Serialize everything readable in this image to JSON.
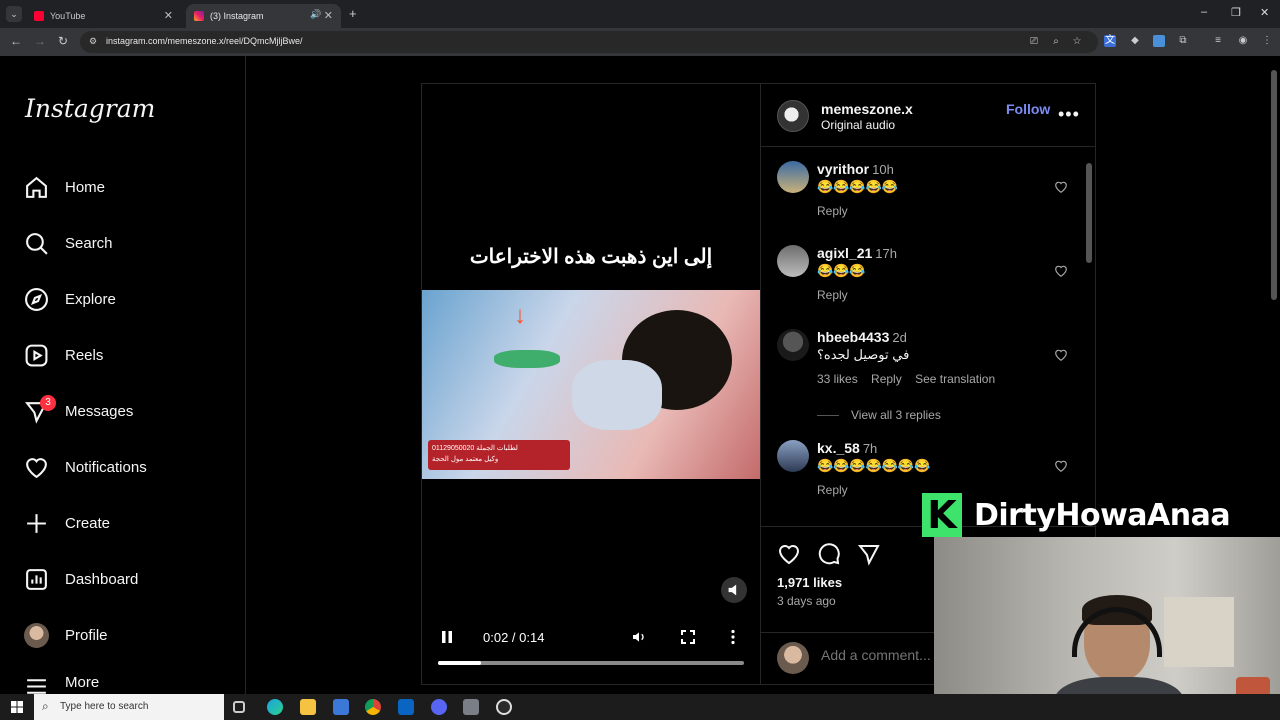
{
  "browser": {
    "tabs": [
      {
        "title": "YouTube",
        "active": false
      },
      {
        "title": "(3) Instagram",
        "active": true
      }
    ],
    "url": "instagram.com/memeszone.x/reel/DQmcMjljBwe/"
  },
  "sidebar": {
    "logo": "Instagram",
    "items": [
      {
        "label": "Home",
        "icon": "home-icon"
      },
      {
        "label": "Search",
        "icon": "search-icon"
      },
      {
        "label": "Explore",
        "icon": "compass-icon"
      },
      {
        "label": "Reels",
        "icon": "reels-icon"
      },
      {
        "label": "Messages",
        "icon": "messenger-icon",
        "badge": "3"
      },
      {
        "label": "Notifications",
        "icon": "heart-icon"
      },
      {
        "label": "Create",
        "icon": "plus-icon"
      },
      {
        "label": "Dashboard",
        "icon": "dashboard-icon"
      },
      {
        "label": "Profile",
        "icon": "avatar"
      },
      {
        "label": "More",
        "icon": "menu-icon"
      }
    ]
  },
  "video": {
    "caption": "إلى اين ذهبت هذه الاختراعات",
    "ad_text_line1": "لطلبات الجملة 01129050020",
    "ad_text_line2": "وكيل معتمد مول الحجة",
    "time": "0:02 / 0:14",
    "progress": 0.14
  },
  "post": {
    "author": "memeszone.x",
    "audio": "Original audio",
    "follow_label": "Follow",
    "more_label": "•••",
    "likes": "1,971 likes",
    "posted": "3 days ago",
    "add_comment_placeholder": "Add a comment..."
  },
  "comments": [
    {
      "user": "vyrithor",
      "time": "10h",
      "text": "😂😂😂😂😂",
      "reply": "Reply"
    },
    {
      "user": "agixl_21",
      "time": "17h",
      "text": "😂😂😂",
      "reply": "Reply"
    },
    {
      "user": "hbeeb4433",
      "time": "2d",
      "text": "في توصيل لجده؟",
      "likes": "33 likes",
      "reply": "Reply",
      "translate": "See translation",
      "view_replies": "View all 3 replies"
    },
    {
      "user": "kx._58",
      "time": "7h",
      "text": "😂😂😂😂😂😂😂",
      "reply": "Reply"
    }
  ],
  "overlay": {
    "brand_letter": "K",
    "brand_name": "DirtyHowaAnaa"
  },
  "taskbar": {
    "search_placeholder": "Type here to search"
  },
  "colors": {
    "accent": "#7c8cf5",
    "badge": "#ff3040",
    "brand_green": "#3ee36b"
  }
}
